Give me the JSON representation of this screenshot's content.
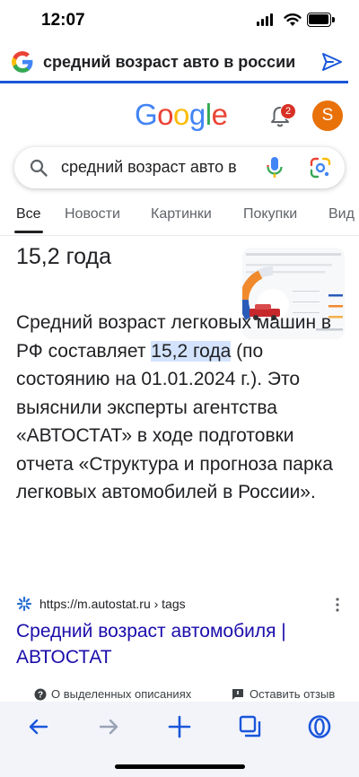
{
  "status_bar": {
    "time": "12:07"
  },
  "address_bar": {
    "text": "средний возраст авто в россии"
  },
  "google": {
    "logo_letters": [
      {
        "ch": "G",
        "color": "#4285F4"
      },
      {
        "ch": "o",
        "color": "#EA4335"
      },
      {
        "ch": "o",
        "color": "#FBBC05"
      },
      {
        "ch": "g",
        "color": "#4285F4"
      },
      {
        "ch": "l",
        "color": "#34A853"
      },
      {
        "ch": "e",
        "color": "#EA4335"
      }
    ],
    "notification_count": "2",
    "avatar_letter": "S"
  },
  "search": {
    "query": "средний возраст авто в"
  },
  "tabs": [
    "Все",
    "Новости",
    "Картинки",
    "Покупки",
    "Вид"
  ],
  "answer": {
    "title": "15,2 года",
    "text_before": "Средний возраст легковых машин в РФ составляет ",
    "highlight": "15,2 года",
    "text_after": " (по состоянию на 01.01.2024 г.). Это выяснили эксперты агентства «АВТОСТАТ» в ходе подготовки отчета «Структура и прогноза парка легковых автомобилей в России»."
  },
  "source": {
    "url": "https://m.autostat.ru › tags",
    "title": "Средний возраст автомобиля | АВТОСТАТ"
  },
  "feedback": {
    "about": "О выделенных описаниях",
    "leave_feedback": "Оставить отзыв"
  },
  "colors": {
    "link": "#1a0dab",
    "highlight": "#d3e3fd",
    "accent": "#1a56db",
    "avatar": "#e8710a",
    "badge": "#d93025"
  }
}
